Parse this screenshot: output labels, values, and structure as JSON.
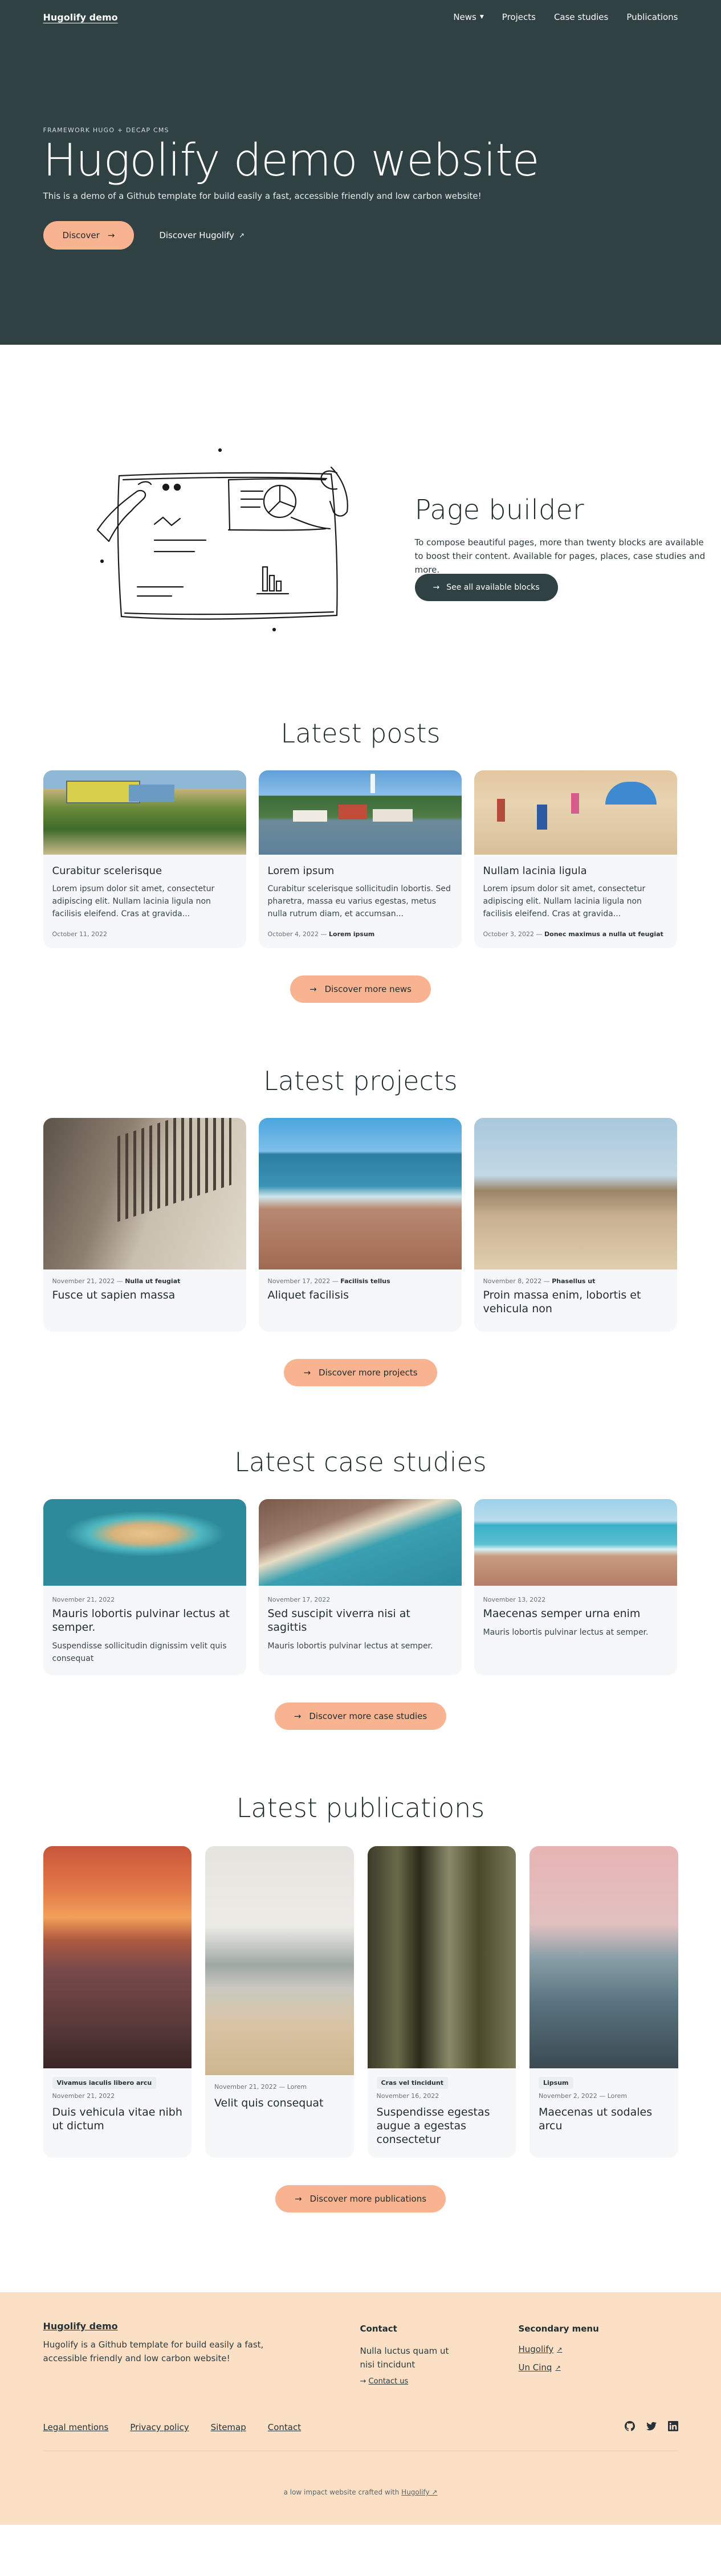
{
  "header": {
    "logo": "Hugolify demo",
    "menu": [
      {
        "label": "News",
        "has_dropdown": true
      },
      {
        "label": "Projects"
      },
      {
        "label": "Case studies"
      },
      {
        "label": "Publications"
      }
    ]
  },
  "hero": {
    "kicker": "FRAMEWORK HUGO + DECAP CMS",
    "title": "Hugolify demo website",
    "subtitle": "This is a demo of a Github template for build easily a fast, accessible friendly and low carbon website!",
    "primary_button": "Discover",
    "secondary_button": "Discover Hugolify"
  },
  "page_builder": {
    "title": "Page builder",
    "text": "To compose beautiful pages, more than twenty blocks are available to boost their content. Available for pages, places, case studies and more.",
    "button": "See all available blocks"
  },
  "posts": {
    "title": "Latest posts",
    "button": "Discover more news",
    "items": [
      {
        "title": "Curabitur scelerisque",
        "excerpt": "Lorem ipsum dolor sit amet, consectetur adipiscing elit. Nullam lacinia ligula non facilisis eleifend. Cras at gravida...",
        "date": "October 11, 2022",
        "author": ""
      },
      {
        "title": "Lorem ipsum",
        "excerpt": "Curabitur scelerisque sollicitudin lobortis. Sed pharetra, massa eu varius egestas, metus nulla rutrum diam, et accumsan...",
        "date": "October 4, 2022",
        "author": "Lorem ipsum"
      },
      {
        "title": "Nullam lacinia ligula",
        "excerpt": "Lorem ipsum dolor sit amet, consectetur adipiscing elit. Nullam lacinia ligula non facilisis eleifend. Cras at gravida...",
        "date": "October 3, 2022",
        "author": "Donec maximus a nulla ut feugiat"
      }
    ]
  },
  "projects": {
    "title": "Latest projects",
    "button": "Discover more projects",
    "items": [
      {
        "date": "November 21, 2022",
        "tag": "Nulla ut feugiat",
        "title": "Fusce ut sapien massa"
      },
      {
        "date": "November 17, 2022",
        "tag": "Facilisis tellus",
        "title": "Aliquet facilisis"
      },
      {
        "date": "November 8, 2022",
        "tag": "Phasellus ut",
        "title": "Proin massa enim, lobortis et vehicula non"
      }
    ]
  },
  "case_studies": {
    "title": "Latest case studies",
    "button": "Discover more case studies",
    "items": [
      {
        "date": "November 21, 2022",
        "title": "Mauris lobortis pulvinar lectus at semper.",
        "excerpt": "Suspendisse sollicitudin dignissim velit quis consequat"
      },
      {
        "date": "November 17, 2022",
        "title": "Sed suscipit viverra nisi at sagittis",
        "excerpt": "Mauris lobortis pulvinar lectus at semper."
      },
      {
        "date": "November 13, 2022",
        "title": "Maecenas semper urna enim",
        "excerpt": "Mauris lobortis pulvinar lectus at semper."
      }
    ]
  },
  "publications": {
    "title": "Latest publications",
    "button": "Discover more publications",
    "items": [
      {
        "badge": "Vivamus iaculis libero arcu",
        "date": "November 21, 2022",
        "tag": "",
        "title": "Duis vehicula vitae nibh ut dictum"
      },
      {
        "badge": "",
        "date": "November 21, 2022",
        "tag": "Lorem",
        "title": "Velit quis consequat"
      },
      {
        "badge": "Cras vel tincidunt",
        "date": "November 16, 2022",
        "tag": "",
        "title": "Suspendisse egestas augue a egestas consectetur"
      },
      {
        "badge": "Lipsum",
        "date": "November 2, 2022",
        "tag": "Lorem",
        "title": "Maecenas ut sodales arcu"
      }
    ]
  },
  "footer": {
    "logo": "Hugolify demo",
    "description": "Hugolify is a Github template for build easily a fast, accessible friendly and low carbon website!",
    "contact_title": "Contact",
    "contact_address": "Nulla luctus quam ut nisi tincidunt",
    "contact_link": "Contact us",
    "secondary_title": "Secondary menu",
    "secondary_links": [
      "Hugolify",
      "Un Cinq"
    ],
    "bottom_links": [
      "Legal mentions",
      "Privacy policy",
      "Sitemap",
      "Contact"
    ],
    "credit_prefix": "a low impact website crafted with",
    "credit_link": "Hugolify"
  },
  "colors": {
    "hero_bg": "#2f4143",
    "accent": "#f8b491",
    "footer_bg": "#fce0c6"
  }
}
